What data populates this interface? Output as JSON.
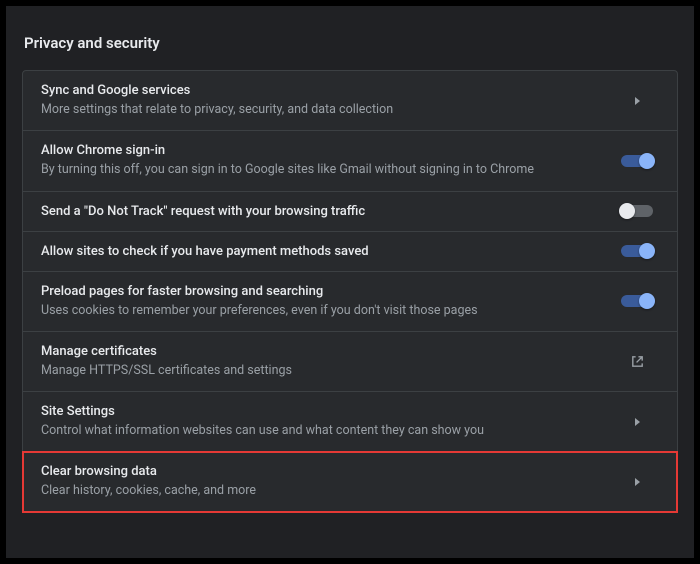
{
  "section_title": "Privacy and security",
  "rows": {
    "sync": {
      "title": "Sync and Google services",
      "sub": "More settings that relate to privacy, security, and data collection"
    },
    "signin": {
      "title": "Allow Chrome sign-in",
      "sub": "By turning this off, you can sign in to Google sites like Gmail without signing in to Chrome"
    },
    "dnt": {
      "title": "Send a \"Do Not Track\" request with your browsing traffic"
    },
    "payment": {
      "title": "Allow sites to check if you have payment methods saved"
    },
    "preload": {
      "title": "Preload pages for faster browsing and searching",
      "sub": "Uses cookies to remember your preferences, even if you don't visit those pages"
    },
    "certs": {
      "title": "Manage certificates",
      "sub": "Manage HTTPS/SSL certificates and settings"
    },
    "site": {
      "title": "Site Settings",
      "sub": "Control what information websites can use and what content they can show you"
    },
    "clear": {
      "title": "Clear browsing data",
      "sub": "Clear history, cookies, cache, and more"
    }
  }
}
